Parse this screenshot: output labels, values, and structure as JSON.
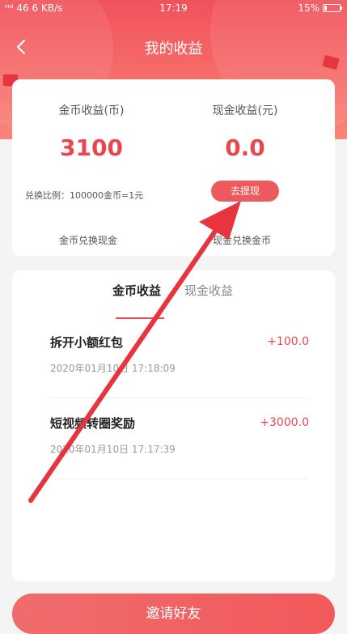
{
  "status_bar": {
    "left": "ᴴᵈ 46 6 KB/s",
    "time": "17:19",
    "battery": "15%",
    "battery_level": 0.15
  },
  "header": {
    "title": "我的收益"
  },
  "summary": {
    "coin_label": "金币收益(币)",
    "coin_value": "3100",
    "cash_label": "现金收益(元)",
    "cash_value": "0.0",
    "ratio_text": "兑换比例：100000金币=1元",
    "withdraw_label": "去提现",
    "coin_to_cash": "金币兑换现金",
    "cash_to_coin": "现金兑换金币"
  },
  "tabs": [
    {
      "label": "金币收益",
      "active": true
    },
    {
      "label": "现金收益",
      "active": false
    }
  ],
  "records": [
    {
      "title": "拆开小额红包",
      "time": "2020年01月10日 17:18:09",
      "amount": "+100.0"
    },
    {
      "title": "短视频转圈奖励",
      "time": "2020年01月10日 17:17:39",
      "amount": "+3000.0"
    }
  ],
  "invite_label": "邀请好友",
  "colors": {
    "accent": "#e9464f",
    "header": "#f0525b",
    "arrow": "#e8343e"
  }
}
